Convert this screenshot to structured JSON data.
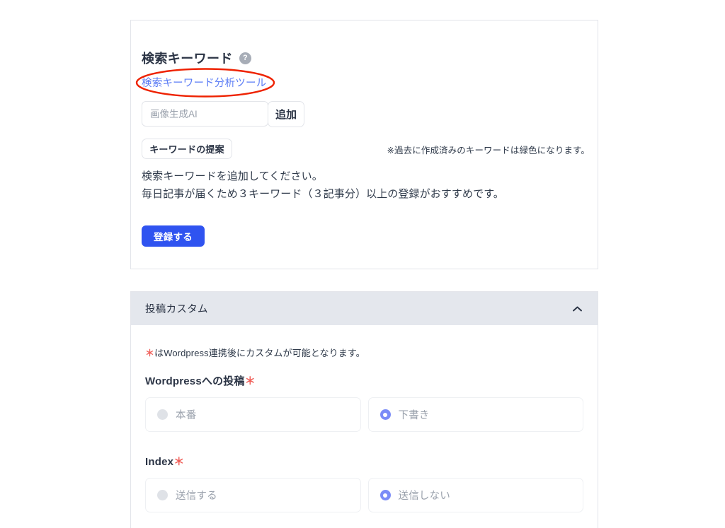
{
  "keyword_card": {
    "title": "検索キーワード",
    "help_icon": "help-circle-icon",
    "analysis_link": "検索キーワード分析ツール",
    "input_placeholder": "画像生成AI",
    "input_value": "",
    "add_button": "追加",
    "suggest_button": "キーワードの提案",
    "note": "※過去に作成済みのキーワードは緑色になります。",
    "description_line1": "検索キーワードを追加してください。",
    "description_line2": "毎日記事が届くため３キーワード（３記事分）以上の登録がおすすめです。",
    "submit_button": "登録する",
    "annotation": {
      "shape": "red-ellipse",
      "color": "#ee2200"
    }
  },
  "custom_card": {
    "header_title": "投稿カスタム",
    "collapse_icon": "chevron-up-icon",
    "required_note_prefix": "＊",
    "required_note": "はWordpress連携後にカスタムが可能となります。",
    "fields": [
      {
        "label": "Wordpressへの投稿",
        "required_mark": "＊",
        "options": [
          {
            "label": "本番",
            "selected": false
          },
          {
            "label": "下書き",
            "selected": true
          }
        ]
      },
      {
        "label": "Index",
        "required_mark": "＊",
        "options": [
          {
            "label": "送信する",
            "selected": false
          },
          {
            "label": "送信しない",
            "selected": true
          }
        ]
      }
    ]
  },
  "colors": {
    "primary": "#2f53f0",
    "link": "#5b7cf5",
    "radio_selected": "#7b8cf7",
    "radio_unselected": "#dfe2e7",
    "required": "#f0605a",
    "header_bg": "#e4e7ed",
    "annotation": "#ee2200"
  }
}
